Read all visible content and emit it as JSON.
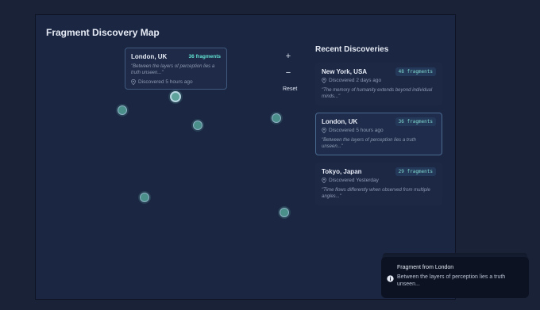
{
  "map": {
    "title": "Fragment Discovery Map",
    "tooltip": {
      "city": "London, UK",
      "count": "36 fragments",
      "quote": "\"Between the layers of perception lies a truth unseen...\"",
      "meta": "Discovered 5 hours ago"
    },
    "controls": {
      "zoom_in": "+",
      "zoom_out": "−",
      "reset": "Reset"
    }
  },
  "recent": {
    "title": "Recent Discoveries",
    "cards": [
      {
        "city": "New York, USA",
        "badge": "48 fragments",
        "meta": "Discovered 2 days ago",
        "quote": "\"The memory of humanity extends beyond individual minds...\""
      },
      {
        "city": "London, UK",
        "badge": "36 fragments",
        "meta": "Discovered 5 hours ago",
        "quote": "\"Between the layers of perception lies a truth unseen...\""
      },
      {
        "city": "Tokyo, Japan",
        "badge": "29 fragments",
        "meta": "Discovered Yesterday",
        "quote": "\"Time flows differently when observed from multiple angles...\""
      }
    ]
  },
  "toast": {
    "title": "Fragment from London",
    "body": "Between the layers of perception lies a truth unseen..."
  },
  "colors": {
    "background": "#1a2238",
    "panel": "#1b2642",
    "accent": "#61e0d0",
    "marker": "#4b8f8a"
  }
}
